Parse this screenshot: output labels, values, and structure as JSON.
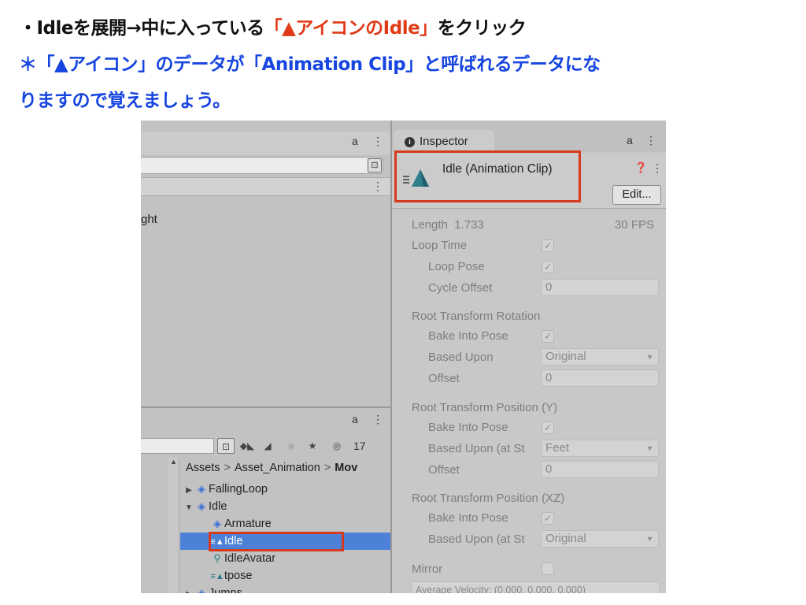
{
  "instructions": {
    "line1_prefix": "・Idleを展開→中に入っている",
    "line1_highlight": "「▲アイコンのIdle」",
    "line1_suffix": "をクリック",
    "line2": "＊「▲アイコン」のデータが「Animation Clip」と呼ばれるデータにな",
    "line3": "りますので覚えましょう。"
  },
  "top_panel": {
    "lock_glyph": "a",
    "menu_glyph": "⋮",
    "picker_glyph": "⊡",
    "partial_text": "ght"
  },
  "project_panel": {
    "count": "17",
    "breadcrumb": [
      "Assets",
      "Asset_Animation",
      "Mov"
    ],
    "breadcrumb_sep": ">",
    "items": [
      {
        "label": "FallingLoop",
        "icon": "prefab-icon",
        "glyph": "◈",
        "expand": "▶"
      },
      {
        "label": "Idle",
        "icon": "prefab-icon",
        "glyph": "◈",
        "expand": "▼"
      },
      {
        "label": "Armature",
        "icon": "prefab-icon",
        "glyph": "◈",
        "expand": ""
      },
      {
        "label": "Idle",
        "icon": "animation-clip-icon",
        "glyph": "≡▲",
        "expand": "",
        "selected": true
      },
      {
        "label": "IdleAvatar",
        "icon": "avatar-icon",
        "glyph": "⚲",
        "expand": ""
      },
      {
        "label": "tpose",
        "icon": "animation-clip-icon",
        "glyph": "≡▲",
        "expand": ""
      },
      {
        "label": "Jumps",
        "icon": "prefab-icon",
        "glyph": "◈",
        "expand": "▶"
      }
    ]
  },
  "inspector": {
    "tab_label": "Inspector",
    "title": "Idle (Animation Clip)",
    "edit_label": "Edit...",
    "length_label": "Length",
    "length_value": "1.733",
    "fps": "30 FPS",
    "loop_time": "Loop Time",
    "loop_pose": "Loop Pose",
    "cycle_offset": "Cycle Offset",
    "cycle_offset_value": "0",
    "root_rotation": "Root Transform Rotation",
    "bake_into_pose": "Bake Into Pose",
    "based_upon": "Based Upon",
    "based_upon_value": "Original",
    "offset": "Offset",
    "offset_value": "0",
    "root_pos_y": "Root Transform Position (Y)",
    "based_upon_at_start": "Based Upon (at St",
    "pos_y_based_value": "Feet",
    "root_pos_xz": "Root Transform Position (XZ)",
    "pos_xz_based_value": "Original",
    "mirror": "Mirror",
    "avg_velocity": "Average Velocity: (0.000, 0.000, 0.000)",
    "check_glyph": "✓",
    "dropdown_glyph": "▼"
  },
  "colors": {
    "instruction_black": "#111111",
    "instruction_highlight": "#e03a16",
    "instruction_blue": "#1645e0",
    "selection_blue": "#4d81d7",
    "callout_red": "#d63a1e"
  }
}
